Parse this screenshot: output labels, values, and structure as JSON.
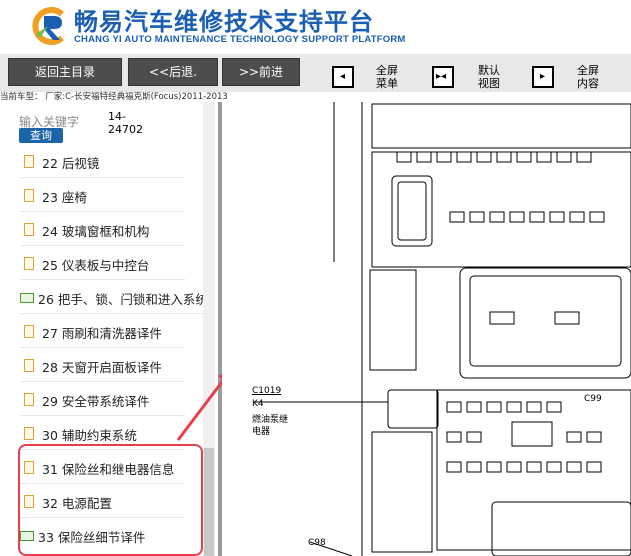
{
  "header": {
    "title_cn": "畅易汽车维修技术支持平台",
    "title_en": "CHANG YI AUTO MAINTENANCE TECHNOLOGY SUPPORT PLATFORM",
    "logo_icon": "c-r-logo-icon",
    "brand_color": "#1a5fb4"
  },
  "toolbar": {
    "back_main": "返回主目录",
    "back": "<<后退.",
    "forward": ">>前进",
    "full_menu": "全屏菜单",
    "default_view": "默认视图",
    "full_content": "全屏内容"
  },
  "car_info": "当前车型： 厂家:C-长安福特经典福克斯(Focus)2011-2013",
  "search": {
    "placeholder": "输入关键字",
    "code": "14-24702",
    "query_button": "查询"
  },
  "tree": {
    "items": [
      {
        "label": "22 后视镜",
        "icon": "document-icon"
      },
      {
        "label": "23 座椅",
        "icon": "document-icon"
      },
      {
        "label": "24 玻璃窗框和机构",
        "icon": "document-icon"
      },
      {
        "label": "25 仪表板与中控台",
        "icon": "document-icon"
      },
      {
        "label": "26 把手、锁、闩锁和进入系统",
        "icon": "folder-icon"
      },
      {
        "label": "27 雨刷和清洗器译件",
        "icon": "document-icon"
      },
      {
        "label": "28 天窗开启面板译件",
        "icon": "document-icon"
      },
      {
        "label": "29 安全带系统译件",
        "icon": "document-icon"
      },
      {
        "label": "30 辅助约束系统",
        "icon": "document-icon"
      },
      {
        "label": "31 保险丝和继电器信息",
        "icon": "document-icon"
      },
      {
        "label": "32 电源配置",
        "icon": "document-icon"
      },
      {
        "label": "33 保险丝细节译件",
        "icon": "folder-icon"
      }
    ]
  },
  "diagram": {
    "connector_c1019": "C1019",
    "relay_k4": "K4",
    "relay_name_1": "燃油泵继",
    "relay_name_2": "电器",
    "connector_c99": "C99",
    "connector_c98": "C98"
  },
  "colors": {
    "highlight": "#e8404a",
    "query_button": "#1a64a8"
  }
}
